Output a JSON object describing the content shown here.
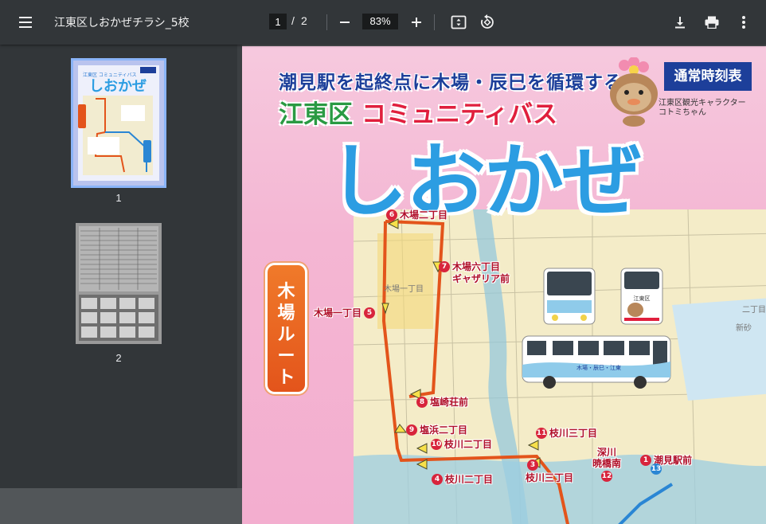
{
  "toolbar": {
    "title": "江東区しおかぜチラシ_5校",
    "current_page": "1",
    "page_separator": "/",
    "total_pages": "2",
    "zoom": "83%",
    "icons": [
      "menu-icon",
      "zoom-out-icon",
      "zoom-in-icon",
      "fit-page-icon",
      "rotate-icon",
      "download-icon",
      "print-icon",
      "more-vert-icon"
    ]
  },
  "sidebar": {
    "thumbnails": [
      {
        "label": "1",
        "selected": true
      },
      {
        "label": "2",
        "selected": false
      }
    ]
  },
  "document": {
    "headline_1": "潮見駅を起終点に木場・辰巳を循環する",
    "headline_2_ward": "江東区",
    "headline_2_bus": "コミュニティバス",
    "title": "しおかぜ",
    "badge": "通常時刻表",
    "character_caption_1": "江東区観光キャラクター",
    "character_caption_2": "コトミちゃん",
    "route_name": "木場ルート",
    "stops": [
      {
        "num": "6",
        "name": "木場二丁目"
      },
      {
        "num": "7",
        "name": "木場六丁目"
      },
      {
        "num": "",
        "name": "ギャザリア前"
      },
      {
        "num": "5",
        "name": "木場一丁目"
      },
      {
        "num": "8",
        "name": "塩崎荘前"
      },
      {
        "num": "9",
        "name": "塩浜二丁目"
      },
      {
        "num": "10",
        "name": "枝川二丁目"
      },
      {
        "num": "11",
        "name": "枝川三丁目"
      },
      {
        "num": "3",
        "name": "枝川三丁目"
      },
      {
        "num": "4",
        "name": "枝川二丁目"
      },
      {
        "num": "12",
        "name": "深川"
      },
      {
        "num": "",
        "name": "暁橋南"
      },
      {
        "num": "1",
        "name": "潮見駅前"
      },
      {
        "num": "13",
        "name": ""
      }
    ],
    "map_labels": [
      "木場一丁目",
      "新砂",
      "二丁目"
    ],
    "bus_sign": "江東区",
    "bus_wrap_text": "木場・辰巳・江東"
  },
  "colors": {
    "toolbar_bg": "#323639",
    "viewer_bg": "#525659",
    "page_pink": "#f4b6d3",
    "title_blue": "#2c9de2",
    "ward_green": "#2a9a43",
    "bus_red": "#e01f3d",
    "route_orange": "#e3541b",
    "badge_navy": "#1d3f9a"
  }
}
